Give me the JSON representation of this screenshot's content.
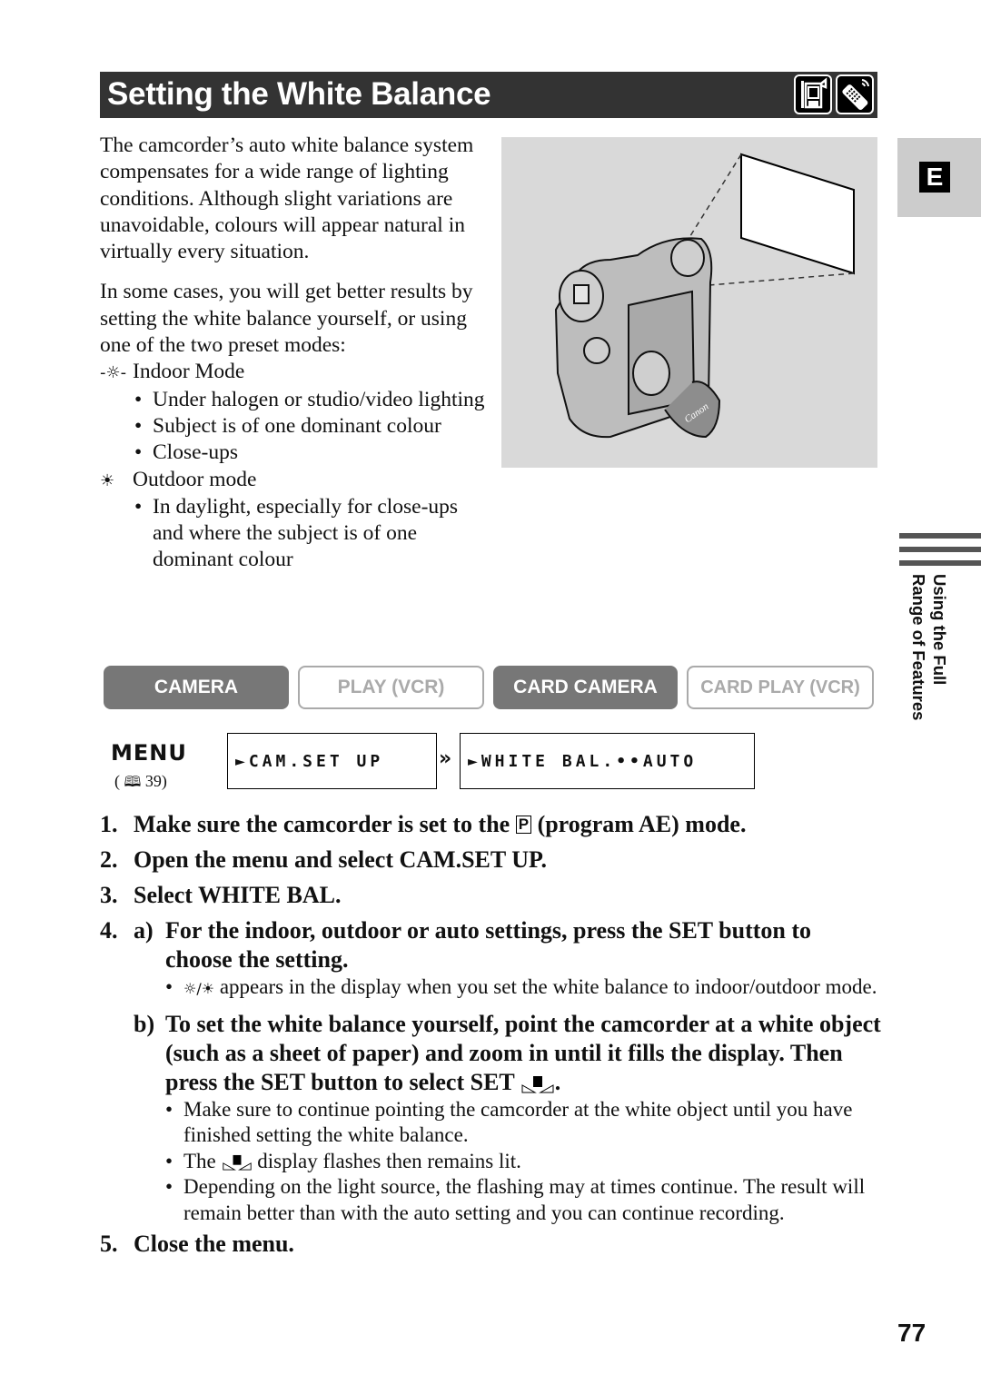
{
  "header": {
    "title": "Setting the White Balance",
    "icons": [
      "camcorder-icon",
      "remote-control-icon"
    ]
  },
  "intro": {
    "paragraph1": "The camcorder’s auto white balance system compensates for a wide range of lighting conditions. Although slight variations are unavoidable, colours will appear natural in virtually every situation.",
    "paragraph2": "In some cases, you will get better results by setting the white balance yourself, or using one of the two preset modes:",
    "modes": [
      {
        "icon": "indoor-bulb-icon",
        "label": "Indoor Mode",
        "bullets": [
          "Under halogen or studio/video lighting",
          "Subject is of one dominant colour",
          "Close-ups"
        ]
      },
      {
        "icon": "outdoor-sun-icon",
        "label": "Outdoor mode",
        "bullets": [
          "In daylight, especially for close-ups and where the subject is of one dominant colour"
        ]
      }
    ]
  },
  "illustration": {
    "brand_text": "Canon"
  },
  "side_tab": {
    "letter": "E",
    "section_line1": "Using the Full",
    "section_line2": "Range of Features"
  },
  "mode_buttons": [
    {
      "label": "CAMERA",
      "active": true
    },
    {
      "label": "PLAY (VCR)",
      "active": false
    },
    {
      "label": "CARD CAMERA",
      "active": true
    },
    {
      "label": "CARD PLAY (VCR)",
      "active": false
    }
  ],
  "menu": {
    "label": "MENU",
    "page_ref": "39",
    "lcd1": "►CAM.SET UP",
    "lcd2": "►WHITE BAL.••AUTO"
  },
  "steps": {
    "s1_num": "1.",
    "s1_a": "Make sure the camcorder is set to the",
    "s1_p": "P",
    "s1_b": "(program AE) mode.",
    "s2_num": "2.",
    "s2": "Open the menu and select CAM.SET UP.",
    "s3_num": "3.",
    "s3": "Select WHITE BAL.",
    "s4_num": "4.",
    "s4a_label": "a)",
    "s4a": "For the indoor, outdoor or auto settings, press the SET button to choose the setting.",
    "s4a_note": "appears in the display when you set the white balance to indoor/outdoor mode.",
    "s4b_label": "b)",
    "s4b": "To set the white balance yourself, point the camcorder at a white object (such as a sheet of paper) and zoom in until it fills the display. Then press the SET button to select SET",
    "s4b_notes": [
      "Make sure to continue pointing the camcorder at the white object until you have finished setting the white balance.",
      "display flashes then remains lit.",
      "Depending on the light source, the flashing may at times continue. The result will remain better than with the auto setting and you can continue recording."
    ],
    "s4b_note2_prefix": "The",
    "s5_num": "5.",
    "s5": "Close the menu."
  },
  "page_number": "77"
}
